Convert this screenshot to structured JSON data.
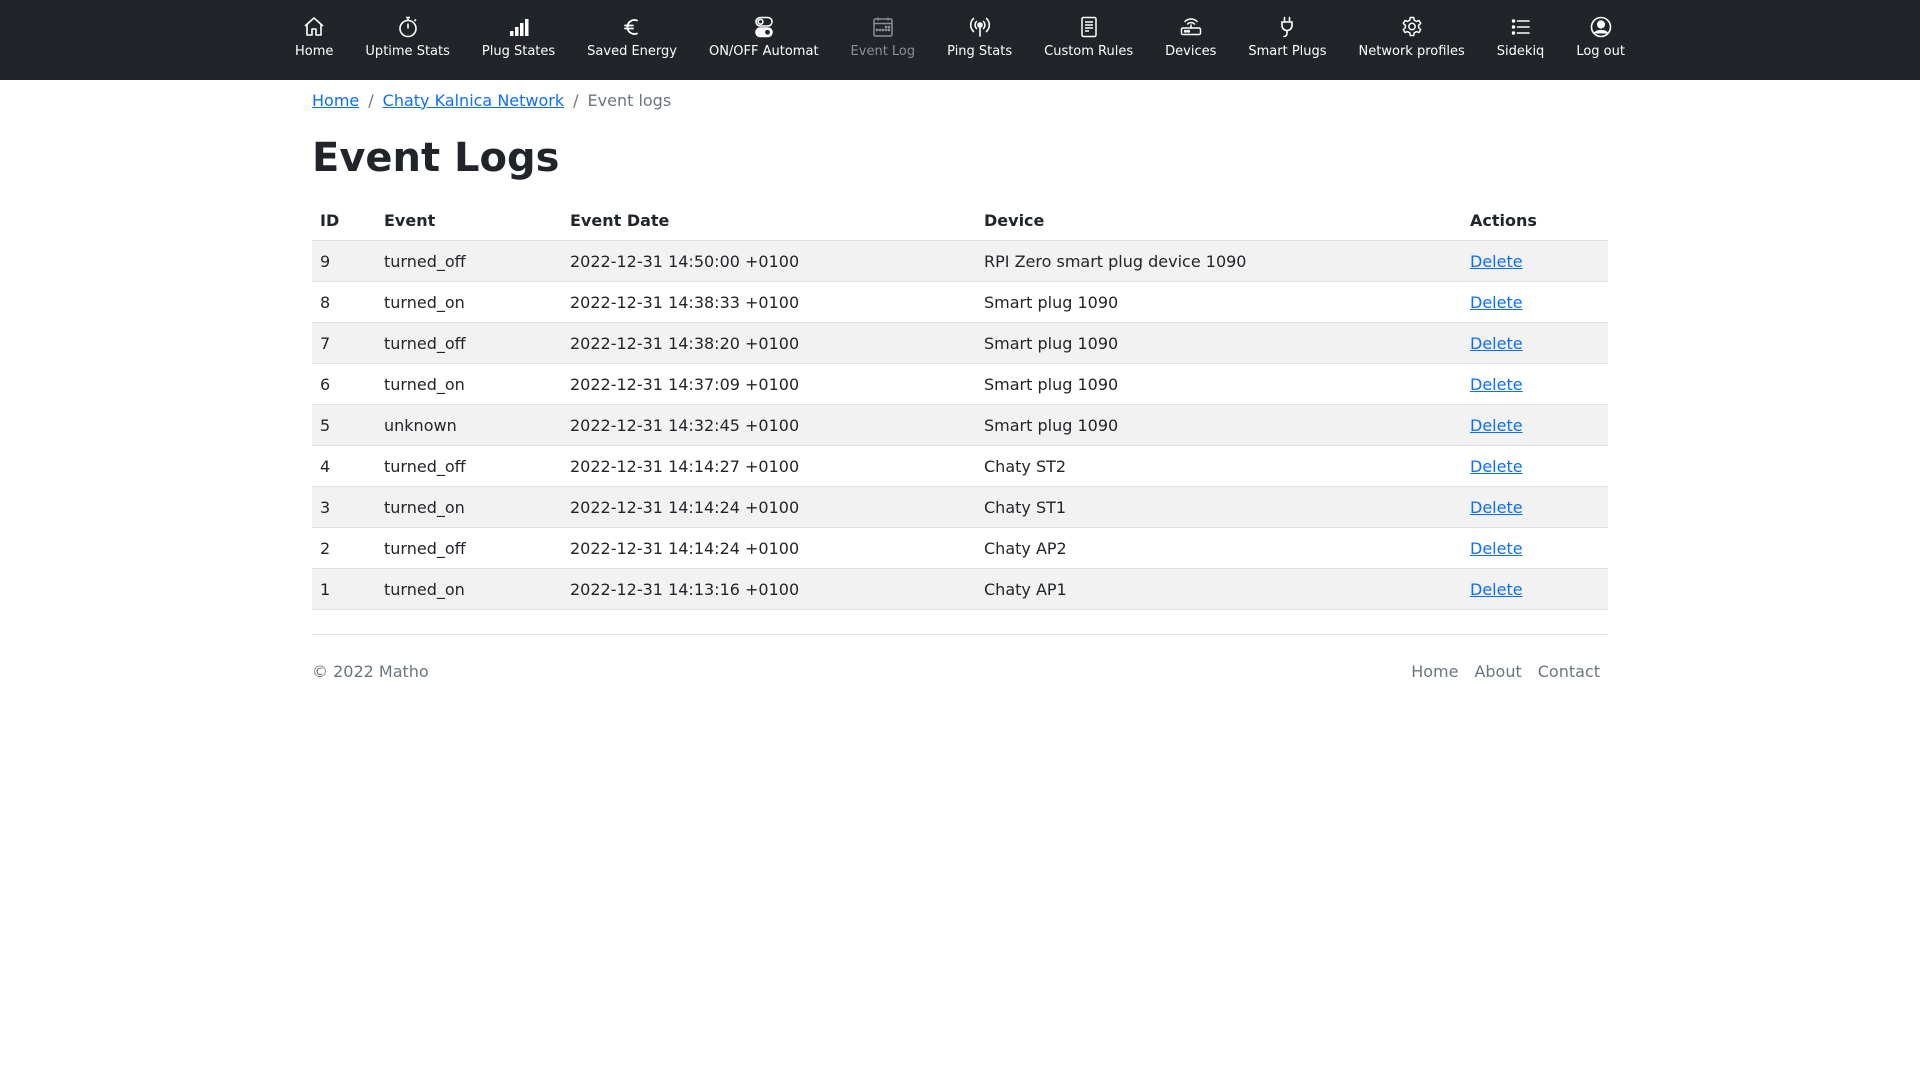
{
  "nav": {
    "items": [
      {
        "label": "Home",
        "icon": "home-icon"
      },
      {
        "label": "Uptime Stats",
        "icon": "stopwatch-icon"
      },
      {
        "label": "Plug States",
        "icon": "bar-signal-icon"
      },
      {
        "label": "Saved Energy",
        "icon": "euro-icon"
      },
      {
        "label": "ON/OFF Automat",
        "icon": "toggles-icon"
      },
      {
        "label": "Event Log",
        "icon": "calendar-icon"
      },
      {
        "label": "Ping Stats",
        "icon": "broadcast-icon"
      },
      {
        "label": "Custom Rules",
        "icon": "document-icon"
      },
      {
        "label": "Devices",
        "icon": "router-icon"
      },
      {
        "label": "Smart Plugs",
        "icon": "plug-icon"
      },
      {
        "label": "Network profiles",
        "icon": "gear-icon"
      },
      {
        "label": "Sidekiq",
        "icon": "list-icon"
      },
      {
        "label": "Log out",
        "icon": "person-circle-icon"
      }
    ],
    "active_index": 5,
    "background": "#212529",
    "text_color": "#ffffff",
    "active_color": "#8a8f94"
  },
  "breadcrumb": {
    "home": "Home",
    "network": "Chaty Kalnica Network",
    "current": "Event logs",
    "separator": "/"
  },
  "page_title": "Event Logs",
  "table": {
    "headers": [
      "ID",
      "Event",
      "Event Date",
      "Device",
      "Actions"
    ],
    "rows": [
      {
        "id": "9",
        "event": "turned_off",
        "date": "2022-12-31 14:50:00 +0100",
        "device": "RPI Zero smart plug device 1090",
        "action": "Delete"
      },
      {
        "id": "8",
        "event": "turned_on",
        "date": "2022-12-31 14:38:33 +0100",
        "device": "Smart plug 1090",
        "action": "Delete"
      },
      {
        "id": "7",
        "event": "turned_off",
        "date": "2022-12-31 14:38:20 +0100",
        "device": "Smart plug 1090",
        "action": "Delete"
      },
      {
        "id": "6",
        "event": "turned_on",
        "date": "2022-12-31 14:37:09 +0100",
        "device": "Smart plug 1090",
        "action": "Delete"
      },
      {
        "id": "5",
        "event": "unknown",
        "date": "2022-12-31 14:32:45 +0100",
        "device": "Smart plug 1090",
        "action": "Delete"
      },
      {
        "id": "4",
        "event": "turned_off",
        "date": "2022-12-31 14:14:27 +0100",
        "device": "Chaty ST2",
        "action": "Delete"
      },
      {
        "id": "3",
        "event": "turned_on",
        "date": "2022-12-31 14:14:24 +0100",
        "device": "Chaty ST1",
        "action": "Delete"
      },
      {
        "id": "2",
        "event": "turned_off",
        "date": "2022-12-31 14:14:24 +0100",
        "device": "Chaty AP2",
        "action": "Delete"
      },
      {
        "id": "1",
        "event": "turned_on",
        "date": "2022-12-31 14:13:16 +0100",
        "device": "Chaty AP1",
        "action": "Delete"
      }
    ]
  },
  "footer": {
    "copyright": "© 2022 Matho",
    "links": [
      "Home",
      "About",
      "Contact"
    ]
  }
}
